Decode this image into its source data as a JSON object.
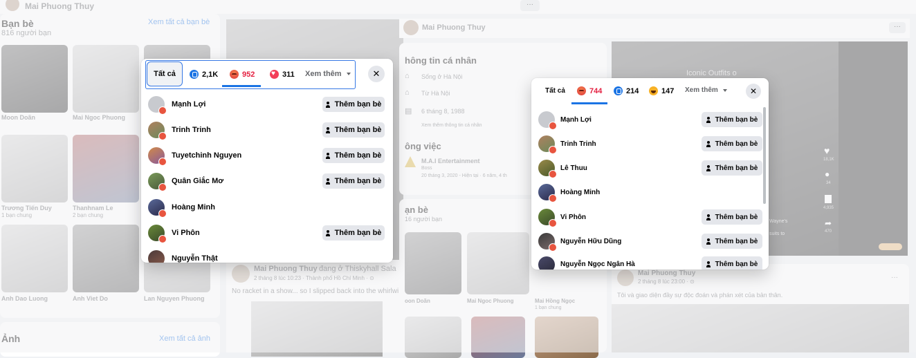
{
  "topbar": {
    "name": "Mai Phuong Thuy",
    "more": "···"
  },
  "friends_left": {
    "title": "Bạn bè",
    "count": "816 người bạn",
    "see_all": "Xem tất cả bạn bè",
    "names": [
      "Moon Doãn",
      "Mai Ngoc Phuong",
      "Trương Tiến Duy",
      "Thanhnam Le",
      "Anh Dao Luong",
      "Anh Viet Do",
      "Lan Nguyen Phuong"
    ],
    "sub1": "1 bạn chung",
    "sub2": "2 bạn chung"
  },
  "photos": {
    "title": "Ảnh",
    "see_all": "Xem tất cả ảnh"
  },
  "post_left": {
    "author": "Mai Phuong Thuy",
    "checkin": "đang ở Thiskyhall Sala",
    "meta": "2 tháng 8 lúc 10:23 · Thành phố Hồ Chí Minh · ⊙",
    "text": "No racket in a show... so I slipped back into the whirlwi"
  },
  "middle": {
    "profile_name": "Mai Phuong Thuy",
    "more": "···",
    "info_title": "hông tin cá nhân",
    "lives": "Sống ở Hà Nội",
    "from": "Từ Hà Nội",
    "birthday": "6 tháng 8, 1988",
    "see_more_info": "Xem thêm thông tin cá nhân",
    "work_title": "ông việc",
    "company": "M.A.I Entertainment",
    "role": "Boss",
    "work_period": "20 tháng 3, 2020 - Hiện tại · 6 năm, 4 th",
    "friends_title": "ạn bè",
    "friends_count": "16 người bạn",
    "friend_names": [
      "oon Doãn",
      "Mai Ngoc Phuong",
      "Mai Hồng Ngọc"
    ],
    "friend_sub": "1 bạn chung"
  },
  "right": {
    "video_title": "Iconic Outfits o",
    "likes": "18,1K",
    "comments": "34",
    "saves": "4,935",
    "shares": "470",
    "caption1": "Wayne's",
    "caption2": "suits to",
    "post_author": "Mai Phuong Thuy",
    "post_meta": "2 tháng 8 lúc 23:00 · ⊙",
    "post_text": "Tôi và giao diện đầy sự độc đoán và phán xét của bản thân.",
    "more": "···"
  },
  "modal1": {
    "tab_all": "Tất cả",
    "like_count": "2,1K",
    "angry_count": "952",
    "love_count": "311",
    "more": "Xem thêm",
    "close": "✕",
    "add_label": "Thêm bạn bè",
    "people": [
      "Mạnh Lợi",
      "Trinh Trinh",
      "Tuyetchinh Nguyen",
      "Quân Giắc Mơ",
      "Hoàng Minh",
      "Vi Phôn",
      "Nguyễn Thật"
    ]
  },
  "modal2": {
    "tab_all": "Tất cả",
    "angry_count": "744",
    "like_count": "214",
    "haha_count": "147",
    "more": "Xem thêm",
    "close": "✕",
    "add_label": "Thêm bạn bè",
    "people": [
      "Mạnh Lợi",
      "Trinh Trinh",
      "Lê Thuu",
      "Hoàng Minh",
      "Vi Phôn",
      "Nguyễn Hữu Dũng",
      "Nguyễn Ngọc Ngân Hà"
    ]
  },
  "colors": {
    "accent_red": "#e41e3f",
    "accent_blue": "#1b74e4",
    "highlight_border": "#3578e5"
  }
}
